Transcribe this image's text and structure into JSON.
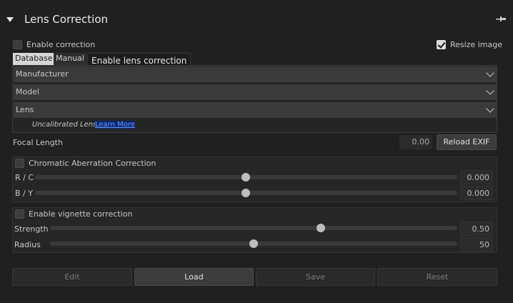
{
  "header": {
    "title": "Lens Correction"
  },
  "options": {
    "enable_correction": {
      "label": "Enable correction",
      "checked": false
    },
    "resize_image": {
      "label": "Resize image",
      "checked": true
    }
  },
  "tabs": [
    {
      "label": "Database",
      "active": true
    },
    {
      "label": "Manual",
      "active": false
    }
  ],
  "tooltip": "Enable lens correction",
  "database": {
    "manufacturer": "Manufacturer",
    "model": "Model",
    "lens": "Lens",
    "uncalibrated_text": "Uncalibrated Lens",
    "learn_more": "Learn More"
  },
  "focal": {
    "label": "Focal Length",
    "value": "0.00",
    "reload_button": "Reload EXIF"
  },
  "chromatic": {
    "title": "Chromatic Aberration Correction",
    "checked": false,
    "rc": {
      "label": "R / C",
      "value": "0.000",
      "position": 0.5
    },
    "by": {
      "label": "B / Y",
      "value": "0.000",
      "position": 0.5
    }
  },
  "vignette": {
    "title": "Enable vignette correction",
    "checked": false,
    "strength": {
      "label": "Strength",
      "value": "0.50",
      "position": 0.66
    },
    "radius": {
      "label": "Radius",
      "value": "50",
      "position": 0.5
    }
  },
  "buttons": {
    "edit": "Edit",
    "load": "Load",
    "save": "Save",
    "reset": "Reset"
  },
  "colors": {
    "background": "#202020",
    "panel": "#262626",
    "accent_link": "#6f95ff"
  }
}
